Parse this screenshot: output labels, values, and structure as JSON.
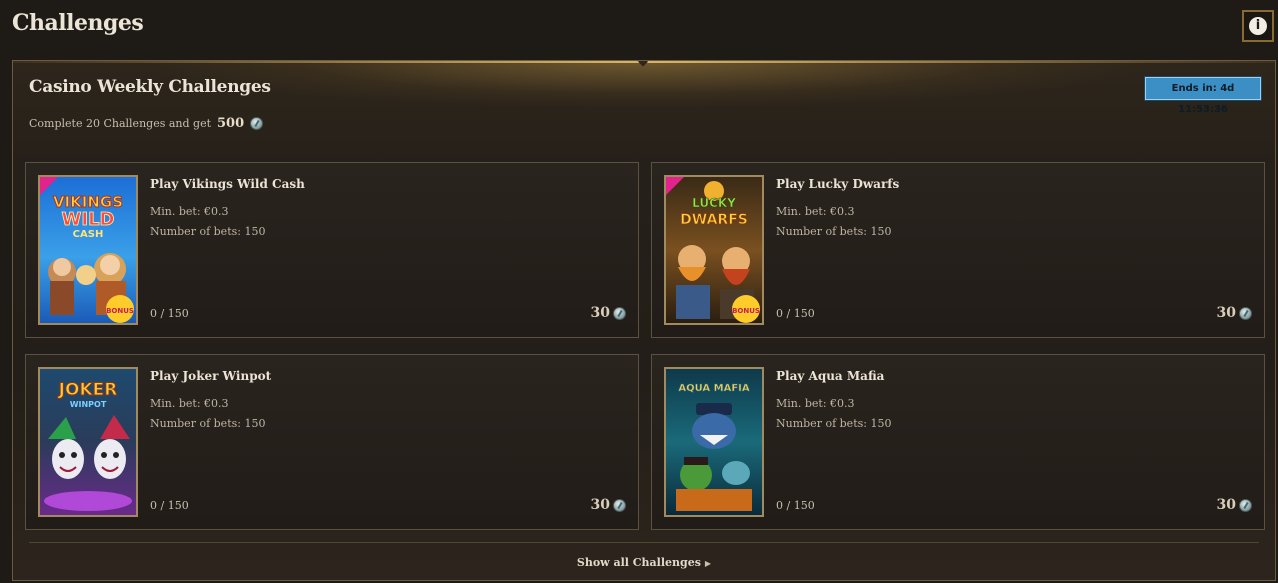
{
  "header": {
    "title": "Challenges",
    "info_icon": "info-icon"
  },
  "panel": {
    "title": "Casino Weekly Challenges",
    "subtitle": "Complete 20 Challenges and get",
    "reward_amount": "500",
    "ends_label": "Ends in: 4d 11:53:36",
    "show_all_label": "Show all Challenges",
    "accent_color": "#d8b468",
    "badge_color": "#3b8fc4"
  },
  "challenges": [
    {
      "title": "Play Vikings Wild Cash",
      "min_bet": "Min. bet: €0.3",
      "num_bets": "Number of bets: 150",
      "progress": "0 / 150",
      "reward": "30",
      "thumb_text_1": "VIKINGS",
      "thumb_text_2": "WILD",
      "thumb_text_3": "CASH",
      "ribbon": "BONUS"
    },
    {
      "title": "Play Lucky Dwarfs",
      "min_bet": "Min. bet: €0.3",
      "num_bets": "Number of bets: 150",
      "progress": "0 / 150",
      "reward": "30",
      "thumb_text_1": "LUCKY",
      "thumb_text_2": "DWARFS",
      "ribbon": "BONUS"
    },
    {
      "title": "Play Joker Winpot",
      "min_bet": "Min. bet: €0.3",
      "num_bets": "Number of bets: 150",
      "progress": "0 / 150",
      "reward": "30",
      "thumb_text_1": "JOKER",
      "thumb_text_2": "WINPOT"
    },
    {
      "title": "Play Aqua Mafia",
      "min_bet": "Min. bet: €0.3",
      "num_bets": "Number of bets: 150",
      "progress": "0 / 150",
      "reward": "30",
      "thumb_text_1": "AQUA MAFIA"
    }
  ]
}
